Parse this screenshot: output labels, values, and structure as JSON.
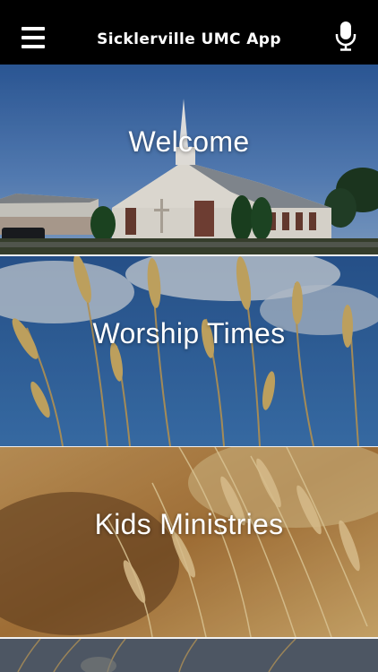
{
  "header": {
    "title": "Sicklerville UMC App",
    "menu_icon": "hamburger-menu-icon",
    "mic_icon": "microphone-icon"
  },
  "tiles": [
    {
      "label": "Welcome"
    },
    {
      "label": "Worship Times"
    },
    {
      "label": "Kids Ministries"
    }
  ],
  "colors": {
    "header_background": "#000000",
    "header_text": "#ffffff"
  }
}
